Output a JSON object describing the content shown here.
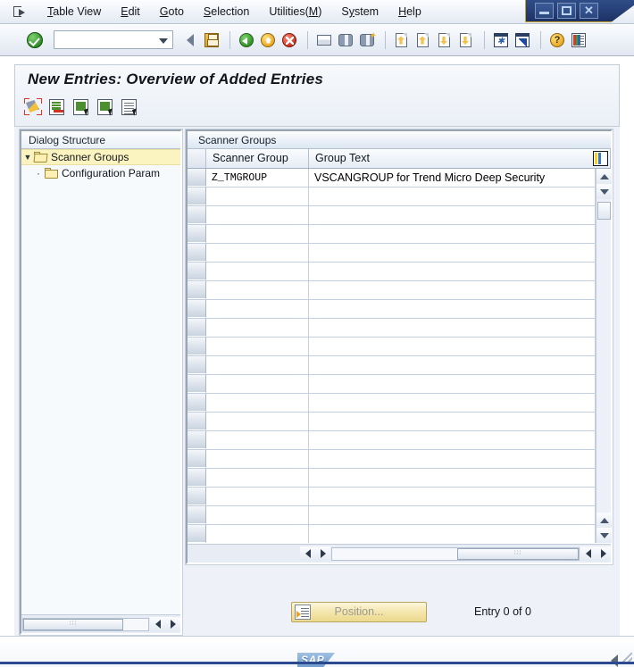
{
  "window": {
    "minimize_label": "—",
    "maximize_label": "□",
    "close_label": "✕"
  },
  "menubar": {
    "system_icon": "session-exit-icon",
    "items": [
      {
        "label": "Table View",
        "accel": "T"
      },
      {
        "label": "Edit",
        "accel": "E"
      },
      {
        "label": "Goto",
        "accel": "G"
      },
      {
        "label": "Selection",
        "accel": "S"
      },
      {
        "label": "Utilities(M)",
        "accel": "M"
      },
      {
        "label": "System",
        "accel": "y"
      },
      {
        "label": "Help",
        "accel": "H"
      }
    ]
  },
  "toolbar": {
    "enter_icon": "green-check-icon",
    "command_field": {
      "value": "",
      "placeholder": ""
    },
    "icons": [
      "back-arrow-icon",
      "save-icon",
      "back-icon",
      "exit-icon",
      "cancel-icon",
      "print-icon",
      "find-icon",
      "find-next-icon",
      "first-page-icon",
      "previous-page-icon",
      "next-page-icon",
      "last-page-icon",
      "create-session-icon",
      "create-shortcut-icon",
      "help-icon",
      "customize-local-layout-icon"
    ],
    "help_glyph": "?"
  },
  "title": {
    "text": "New Entries: Overview of Added Entries"
  },
  "app_toolbar": {
    "icons": [
      "new-entries-icon",
      "delete-entry-icon",
      "copy-entry-icon",
      "select-entry-icon",
      "details-icon"
    ]
  },
  "tree": {
    "header": "Dialog Structure",
    "nodes": [
      {
        "label": "Scanner Groups",
        "selected": true,
        "expanded": true,
        "level": 0
      },
      {
        "label": "Configuration Param",
        "selected": false,
        "expanded": false,
        "level": 1
      }
    ],
    "hscroll": {
      "thumb_grip": "∶∶∶"
    }
  },
  "table": {
    "caption": "Scanner Groups",
    "config_icon": "column-configuration-icon",
    "columns": [
      {
        "label": "Scanner Group"
      },
      {
        "label": "Group Text"
      }
    ],
    "rows": [
      {
        "scanner_group": "Z_TMGROUP",
        "group_text": "VSCANGROUP for Trend Micro Deep Security"
      }
    ],
    "empty_row_count": 19,
    "hscroll": {
      "thumb_grip": "∶∶∶"
    }
  },
  "footer": {
    "position_button": "Position...",
    "position_icon": "position-icon",
    "entry_status": "Entry 0 of 0"
  },
  "statusbar": {
    "logo": "SAP",
    "collapse_icon": "collapse-arrow-icon",
    "resize_grip": "resize-grip-icon"
  },
  "colors": {
    "accent_blue": "#2b4a8f",
    "selection_yellow": "#fbf4c0",
    "panel_bg": "#eef2f8",
    "button_yellow": "#f3e4a8"
  }
}
